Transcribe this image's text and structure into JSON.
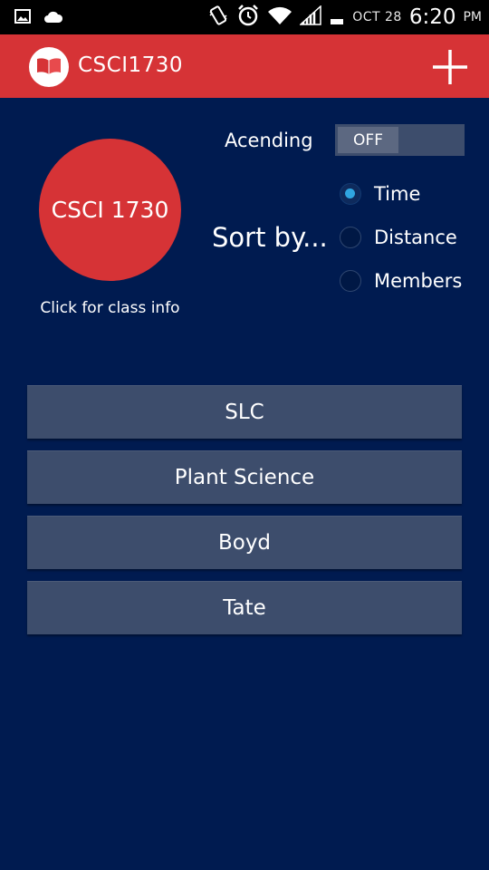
{
  "status_bar": {
    "date": "OCT 28",
    "time": "6:20",
    "ampm": "PM",
    "icons": [
      "image-icon",
      "cloud-icon",
      "vibrate-icon",
      "alarm-icon",
      "wifi-icon",
      "signal-icon",
      "battery-icon"
    ]
  },
  "app_bar": {
    "title": "CSCI1730",
    "logo_icon": "book-icon",
    "action_icon": "plus-icon",
    "color": "#d63336"
  },
  "class_card": {
    "name": "CSCI 1730",
    "hint": "Click for class info"
  },
  "ordering": {
    "label": "Acending",
    "toggle_value": "OFF"
  },
  "sort": {
    "label": "Sort by...",
    "options": [
      {
        "label": "Time",
        "checked": true
      },
      {
        "label": "Distance",
        "checked": false
      },
      {
        "label": "Members",
        "checked": false
      }
    ]
  },
  "locations": [
    "SLC",
    "Plant Science",
    "Boyd",
    "Tate"
  ],
  "colors": {
    "background": "#001b50",
    "button": "#3d4d6c",
    "accent": "#2fa5e0"
  }
}
